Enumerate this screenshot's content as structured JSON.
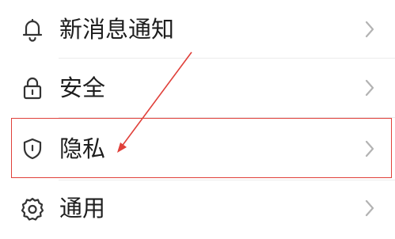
{
  "settings": {
    "items": [
      {
        "label": "新消息通知",
        "icon": "bell-icon"
      },
      {
        "label": "安全",
        "icon": "lock-icon"
      },
      {
        "label": "隐私",
        "icon": "shield-icon"
      },
      {
        "label": "通用",
        "icon": "gear-icon"
      }
    ]
  },
  "colors": {
    "text": "#1d1d1d",
    "icon": "#333333",
    "chevron": "#b3b3b3",
    "divider": "#ececec",
    "annotation": "#e0403a"
  }
}
